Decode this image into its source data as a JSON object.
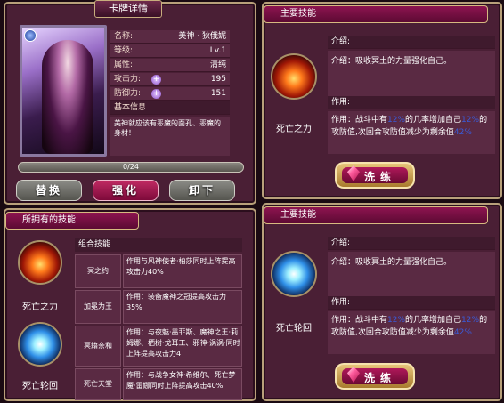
{
  "card": {
    "title": "卡牌详情",
    "fields": [
      {
        "key": "名称:",
        "value": "美神 · 狄俄妮"
      },
      {
        "key": "等级:",
        "value": "Lv.1"
      },
      {
        "key": "属性:",
        "value": "清纯"
      },
      {
        "key": "攻击力:",
        "value": "195"
      },
      {
        "key": "防御力:",
        "value": "151"
      }
    ],
    "info_title": "基本信息",
    "info_text": "美神就应该有恶魔的面孔、恶魔的身材！",
    "exp": "0/24",
    "buttons": {
      "swap": "替换",
      "enhance": "强化",
      "unequip": "卸下"
    }
  },
  "owned": {
    "title": "所拥有的技能",
    "skills": [
      {
        "label": "死亡之力"
      },
      {
        "label": "死亡轮回"
      }
    ],
    "combo_title": "组合技能",
    "combos": [
      {
        "name": "冥之约",
        "desc": "作用与风神使者·柏莎同时上阵提高攻击力40%"
      },
      {
        "name": "加冕为王",
        "desc": "作用：装备魔神之冠提高攻击力35%"
      },
      {
        "name": "冥籍亲和",
        "desc": "作用：与夜魅·墨菲斯、魔神之王·莉姆娜、栖树·戈耳工、邪神·涡涡·同时上阵提高攻击力4"
      },
      {
        "name": "死亡天堂",
        "desc": "作用：与战争女神·希维尔、死亡梦魇·雷娜同时上阵提高攻击40%"
      }
    ]
  },
  "skill_panels": [
    {
      "title": "主要技能",
      "icon_label": "死亡之力",
      "intro_title": "介绍:",
      "intro_text": "介绍：吸收冥土的力量强化自己。",
      "effect_title": "作用:",
      "effect_pre": "作用：战斗中有",
      "effect_pct1": "12%",
      "effect_mid": "的几率增加自己",
      "effect_pct2": "12%",
      "effect_mid2": "的攻防值,次回合攻防值减少为剩余值",
      "effect_pct3": "42%",
      "wash_label": "洗练"
    },
    {
      "title": "主要技能",
      "icon_label": "死亡轮回",
      "intro_title": "介绍:",
      "intro_text": "介绍：吸收冥土的力量强化自己。",
      "effect_title": "作用:",
      "effect_pre": "作用：战斗中有",
      "effect_pct1": "12%",
      "effect_mid": "的几率增加自己",
      "effect_pct2": "12%",
      "effect_mid2": "的攻防值,次回合攻防值减少为剩余值",
      "effect_pct3": "42%",
      "wash_label": "洗练"
    }
  ],
  "colors": {
    "accent": "#a3105a",
    "panel": "#4a1f35",
    "gold": "#b8a07a",
    "highlight_blue": "#3a5bd8"
  }
}
